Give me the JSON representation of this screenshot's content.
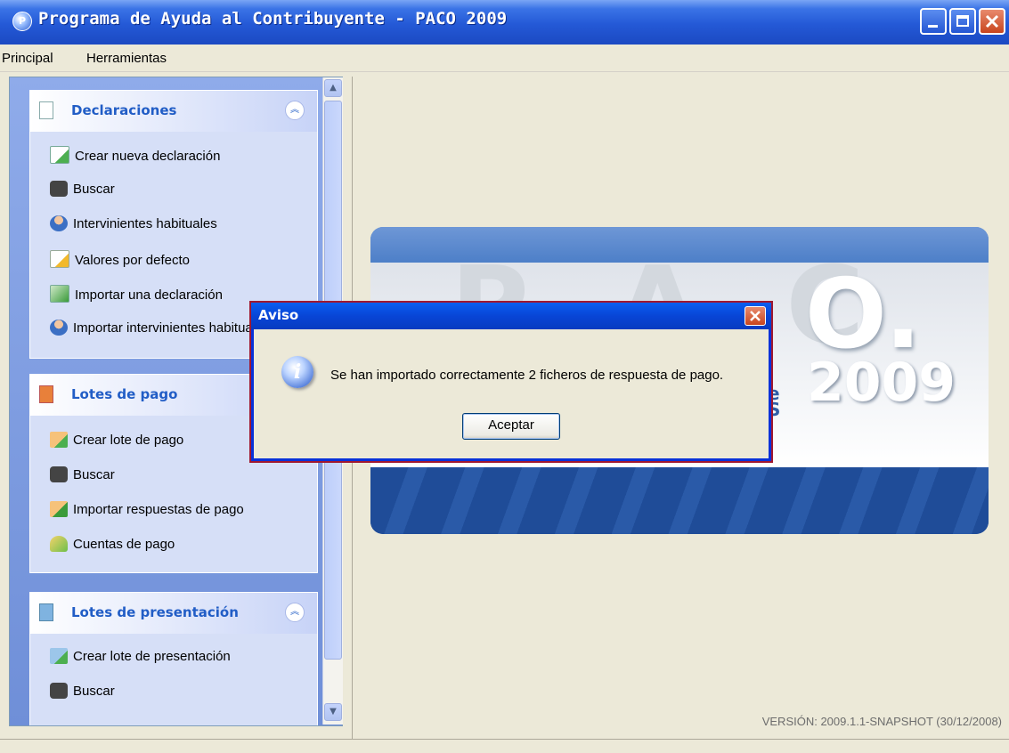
{
  "window": {
    "title": "Programa de Ayuda al Contribuyente - PACO 2009"
  },
  "menu": {
    "items": [
      "Principal",
      "Herramientas"
    ]
  },
  "sidebar": {
    "panels": [
      {
        "title": "Declaraciones",
        "tasks": [
          "Crear nueva declaración",
          "Buscar",
          "Intervinientes habituales",
          "Valores por defecto",
          "Importar una declaración",
          "Importar intervinientes habituales"
        ]
      },
      {
        "title": "Lotes de pago",
        "tasks": [
          "Crear lote de pago",
          "Buscar",
          "Importar respuestas de pago",
          "Cuentas de pago"
        ]
      },
      {
        "title": "Lotes de presentación",
        "tasks": [
          "Crear lote de presentación",
          "Buscar"
        ]
      }
    ]
  },
  "banner": {
    "letters": "P A C",
    "big_o": "O.",
    "year": "2009",
    "partial_text": "e\nS"
  },
  "version": "VERSIÓN: 2009.1.1-SNAPSHOT (30/12/2008)",
  "dialog": {
    "title": "Aviso",
    "message": "Se han importado correctamente 2 ficheros de respuesta de pago.",
    "ok_label": "Aceptar"
  },
  "colors": {
    "titlebar": "#2459d6",
    "panel_title": "#215dc6",
    "dialog_border": "#a01830"
  }
}
